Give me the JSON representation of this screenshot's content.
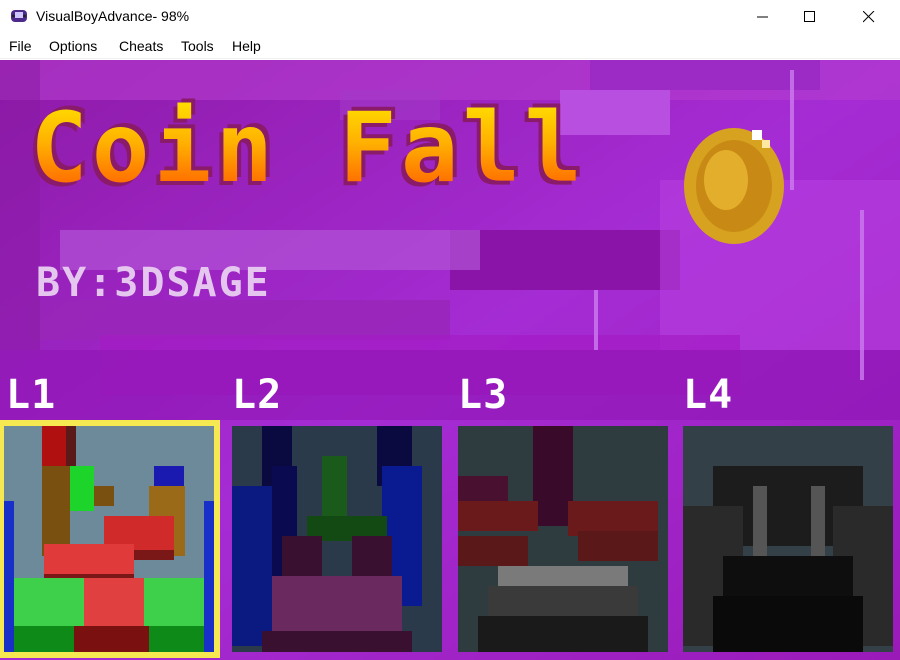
{
  "window": {
    "title": "VisualBoyAdvance- 98%",
    "icon": "gameboy-icon",
    "controls": [
      "minimize-icon",
      "maximize-icon",
      "close-icon"
    ]
  },
  "menu": {
    "items": [
      "File",
      "Options",
      "Cheats",
      "Tools",
      "Help"
    ]
  },
  "game": {
    "title": "Coin Fall",
    "byline": "BY:3DSAGE",
    "coin_icon": "coin-icon",
    "levels": [
      {
        "label": "L1",
        "selected": true
      },
      {
        "label": "L2",
        "selected": false
      },
      {
        "label": "L3",
        "selected": false
      },
      {
        "label": "L4",
        "selected": false
      }
    ],
    "colors": {
      "bg_magenta": "#a21cc6",
      "selection": "#f6e850"
    }
  }
}
